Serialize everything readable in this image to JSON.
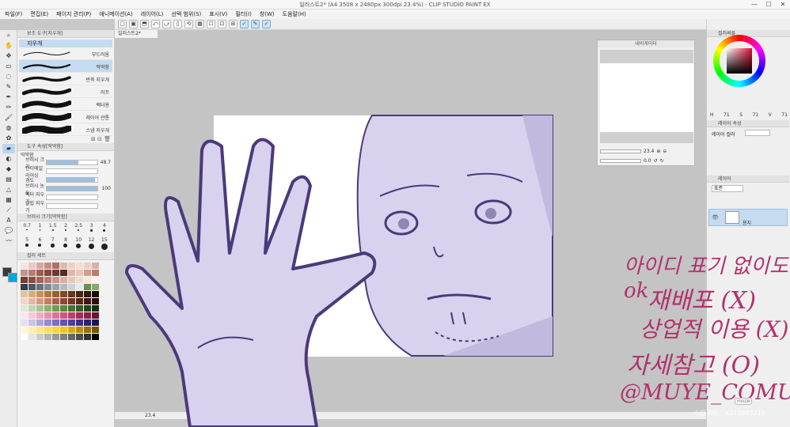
{
  "window": {
    "title": "일러스트2* (A4 3508 x 2480px 300dpi 23.4%) - CLIP STUDIO PAINT EX",
    "minimize": "—",
    "maximize": "☐",
    "close": "✕"
  },
  "menu": [
    "파일(F)",
    "편집(E)",
    "페이지 관리(P)",
    "애니메이션(A)",
    "레이어(L)",
    "선택 범위(S)",
    "표시(V)",
    "필터(I)",
    "창(W)",
    "도움말(H)"
  ],
  "tools": [
    {
      "icon": "zoom-icon",
      "glyph": "⌕"
    },
    {
      "icon": "hand-icon",
      "glyph": "✋"
    },
    {
      "icon": "move-icon",
      "glyph": "✥"
    },
    {
      "icon": "select-icon",
      "glyph": "▭"
    },
    {
      "icon": "lasso-icon",
      "glyph": "◌"
    },
    {
      "icon": "eyedropper-icon",
      "glyph": "✎"
    },
    {
      "icon": "pen-icon",
      "glyph": "✒"
    },
    {
      "icon": "pencil-icon",
      "glyph": "✏"
    },
    {
      "icon": "brush-icon",
      "glyph": "🖌"
    },
    {
      "icon": "airbrush-icon",
      "glyph": "◍"
    },
    {
      "icon": "decoration-icon",
      "glyph": "✿"
    },
    {
      "icon": "eraser-icon",
      "glyph": "▰"
    },
    {
      "icon": "blend-icon",
      "glyph": "◐"
    },
    {
      "icon": "fill-icon",
      "glyph": "◆"
    },
    {
      "icon": "gradient-icon",
      "glyph": "▤"
    },
    {
      "icon": "figure-icon",
      "glyph": "△"
    },
    {
      "icon": "frame-icon",
      "glyph": "▦"
    },
    {
      "icon": "ruler-icon",
      "glyph": "⟋"
    },
    {
      "icon": "text-icon",
      "glyph": "A"
    },
    {
      "icon": "balloon-icon",
      "glyph": "💬"
    },
    {
      "icon": "line-fix-icon",
      "glyph": "〰"
    }
  ],
  "subtool": {
    "panel_title": "보조 도구[지우개]",
    "group": "지우개",
    "brushes": [
      {
        "name": "부드러움",
        "selected": false
      },
      {
        "name": "딱딱함",
        "selected": true
      },
      {
        "name": "반죽 지우개",
        "selected": false
      },
      {
        "name": "러프",
        "selected": false
      },
      {
        "name": "벡터용",
        "selected": false
      },
      {
        "name": "레이어 관통",
        "selected": false
      },
      {
        "name": "스냅 지우개",
        "selected": false
      }
    ]
  },
  "tool_property": {
    "panel_title": "도구 속성[딱딱함]",
    "preset_name": "딱딱함",
    "rows": [
      {
        "label": "브러시 크기",
        "value": "48.7",
        "level": 0.62
      },
      {
        "label": "안티에일리어싱",
        "value": "",
        "level": 0
      },
      {
        "label": "경도",
        "value": "",
        "level": 0.95
      },
      {
        "label": "브러시 농도",
        "value": "100",
        "level": 1.0
      },
      {
        "label": "벡터 지우기",
        "value": "",
        "level": 0
      },
      {
        "label": "슬립 지우기",
        "value": "",
        "level": 0
      }
    ]
  },
  "brush_size": {
    "panel_title": "브러시 크기[딱딱함]",
    "sizes": [
      "0.7",
      "1",
      "1.5",
      "2",
      "2.5",
      "3",
      "4",
      "5",
      "6",
      "7",
      "8",
      "10",
      "12",
      "15"
    ]
  },
  "color_set": {
    "panel_title": "컬러 세트",
    "colors": [
      "#f4e3e0",
      "#e9c9c2",
      "#d9a79c",
      "#c98a7f",
      "#b36d62",
      "#e0b8a8",
      "#f0d0c2",
      "#f6dcd0",
      "#ead0c6",
      "#d6b3a4",
      "#c9928a",
      "#b97c72",
      "#a05a50",
      "#88453d",
      "#703631",
      "#5b2a26",
      "#e8b4a6",
      "#f2c2b4",
      "#d89a8e",
      "#c27a70",
      "#7a3b34",
      "#8e4a42",
      "#a4605a",
      "#b87a70",
      "#cc9388",
      "#ddae9f",
      "#ebc6b8",
      "#f3d8cc",
      "#f8e6dd",
      "#fff1ea",
      "#333f4a",
      "#4b5b66",
      "#65737e",
      "#7e8b94",
      "#98a3aa",
      "#b2bbbf",
      "#cbd3d6",
      "#e5e9ea",
      "#6b8e4e",
      "#88a86a",
      "#e4c39a",
      "#d9ac77",
      "#c99258",
      "#b57940",
      "#9a6130",
      "#7e4c24",
      "#62391b",
      "#472912",
      "#2f1b0c",
      "#1a0f06",
      "#f1d3c9",
      "#e7b6a8",
      "#d99885",
      "#c97a64",
      "#b05e48",
      "#934634",
      "#783324",
      "#5e2418",
      "#44180f",
      "#2c0f09",
      "#dfe8d3",
      "#c3d7b2",
      "#a6c590",
      "#89b26e",
      "#6d9e50",
      "#578a3c",
      "#43752d",
      "#325e20",
      "#234716",
      "#15300d",
      "#fbe6ec",
      "#f5c9d6",
      "#eeacc0",
      "#e68fa9",
      "#dd7293",
      "#d2567d",
      "#c33d68",
      "#a92b55",
      "#8c1f44",
      "#6d1533",
      "#e3e0f5",
      "#c9c3ea",
      "#aea6de",
      "#9389d2",
      "#7a6dc5",
      "#6254b5",
      "#4d409f",
      "#3c3086",
      "#2d236b",
      "#1e1750",
      "#fff7d6",
      "#ffefad",
      "#ffe684",
      "#ffdd5b",
      "#ffd433",
      "#f5c416",
      "#d9a90c",
      "#b98d07",
      "#967104",
      "#725502",
      "#ffffff",
      "#e6e6e6",
      "#cccccc",
      "#b3b3b3",
      "#999999",
      "#808080",
      "#666666",
      "#4d4d4d",
      "#333333",
      "#000000"
    ]
  },
  "commandbar": [
    "▢",
    "▣",
    "⬒",
    "⤺",
    "⤻",
    "▯",
    "⟲",
    "▦",
    "☐",
    "⊡",
    "⊞",
    "✓",
    "✎",
    "✓"
  ],
  "document": {
    "tab": "일러스트2*",
    "zoom": "23.4"
  },
  "navigator": {
    "title": "내비게이터",
    "zoom": "23.4",
    "rotation": "0.0"
  },
  "color_panel": {
    "title": "컬러써클",
    "hsv": [
      "H",
      "71",
      "S",
      "71",
      "V",
      "71"
    ]
  },
  "layer_property": {
    "title": "레이어 속성",
    "effect": "레이어 컬러"
  },
  "layer_panel": {
    "title": "레이어",
    "blend_mode": "표준",
    "layer_name": "용지"
  },
  "handwriting": {
    "line1": "아이디 표기 없이도ok",
    "line2": "재배포 (X)",
    "line3": "상업적 이용 (X)",
    "line4": "자세참고 (O)",
    "line5": "@MUYE_COMU"
  },
  "watermark": {
    "text": "小红书号：4273983215",
    "badge": "moze"
  },
  "colors": {
    "sketch_fill": "#d8d2ee",
    "sketch_line": "#4a3a7a",
    "handwriting": "#b0326c",
    "accent": "#c5dbef"
  }
}
